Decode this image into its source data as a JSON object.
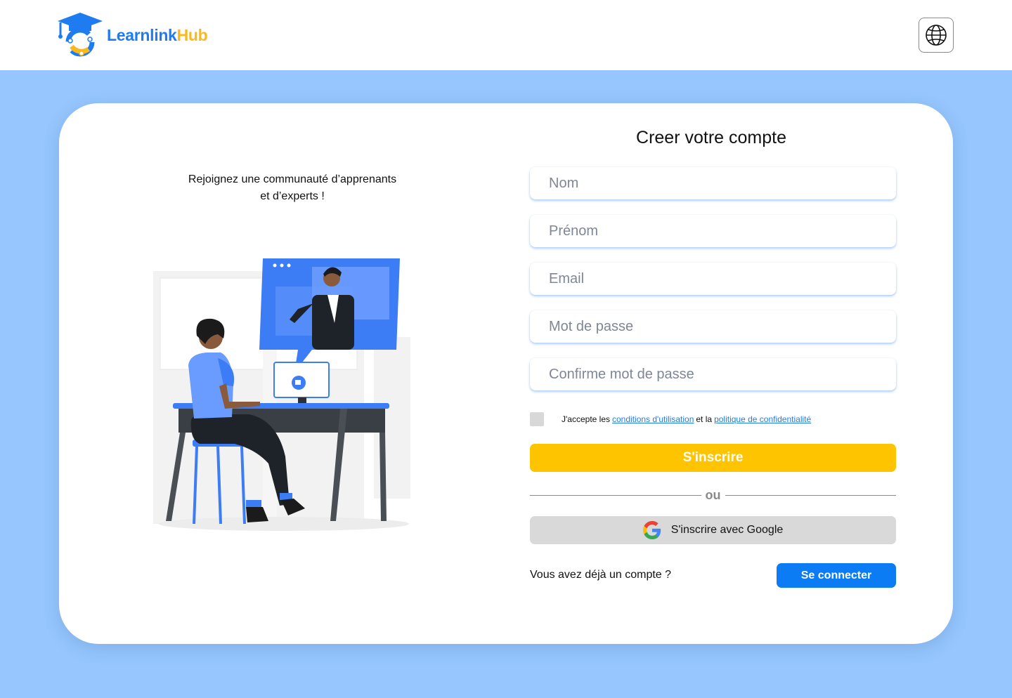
{
  "brand": {
    "name_part1": "Learnlink",
    "name_part2": "Hub",
    "logo_icon": "graduation-cap-logo-icon",
    "colors": {
      "blue": "#1e7cf0",
      "yellow": "#f9b81c"
    }
  },
  "header": {
    "language_icon": "globe-icon"
  },
  "intro": {
    "tagline_line1": "Rejoignez une communauté d’apprenants",
    "tagline_line2": "et d’experts !"
  },
  "form": {
    "title": "Creer votre compte",
    "fields": {
      "nom": {
        "placeholder": "Nom",
        "value": ""
      },
      "prenom": {
        "placeholder": "Prénom",
        "value": ""
      },
      "email": {
        "placeholder": "Email",
        "value": ""
      },
      "password": {
        "placeholder": "Mot de passe",
        "value": ""
      },
      "confirm_password": {
        "placeholder": "Confirme mot de passe",
        "value": ""
      }
    },
    "terms": {
      "prefix": "J'accepte les",
      "terms_link": "conditions d'utilisation",
      "joiner": "et la",
      "privacy_link": "politique de confidentialité",
      "checked": false
    },
    "signup_label": "S'inscrire",
    "divider_label": "ou",
    "google_label": "S'inscrire avec Google",
    "google_icon": "google-icon",
    "have_account_text": "Vous avez déjà un compte ?",
    "login_label": "Se connecter"
  },
  "colors": {
    "page_bg": "#96c6fd",
    "primary_yellow": "#fec400",
    "primary_blue": "#0b7cf4",
    "google_button_bg": "#d9d9d9"
  }
}
